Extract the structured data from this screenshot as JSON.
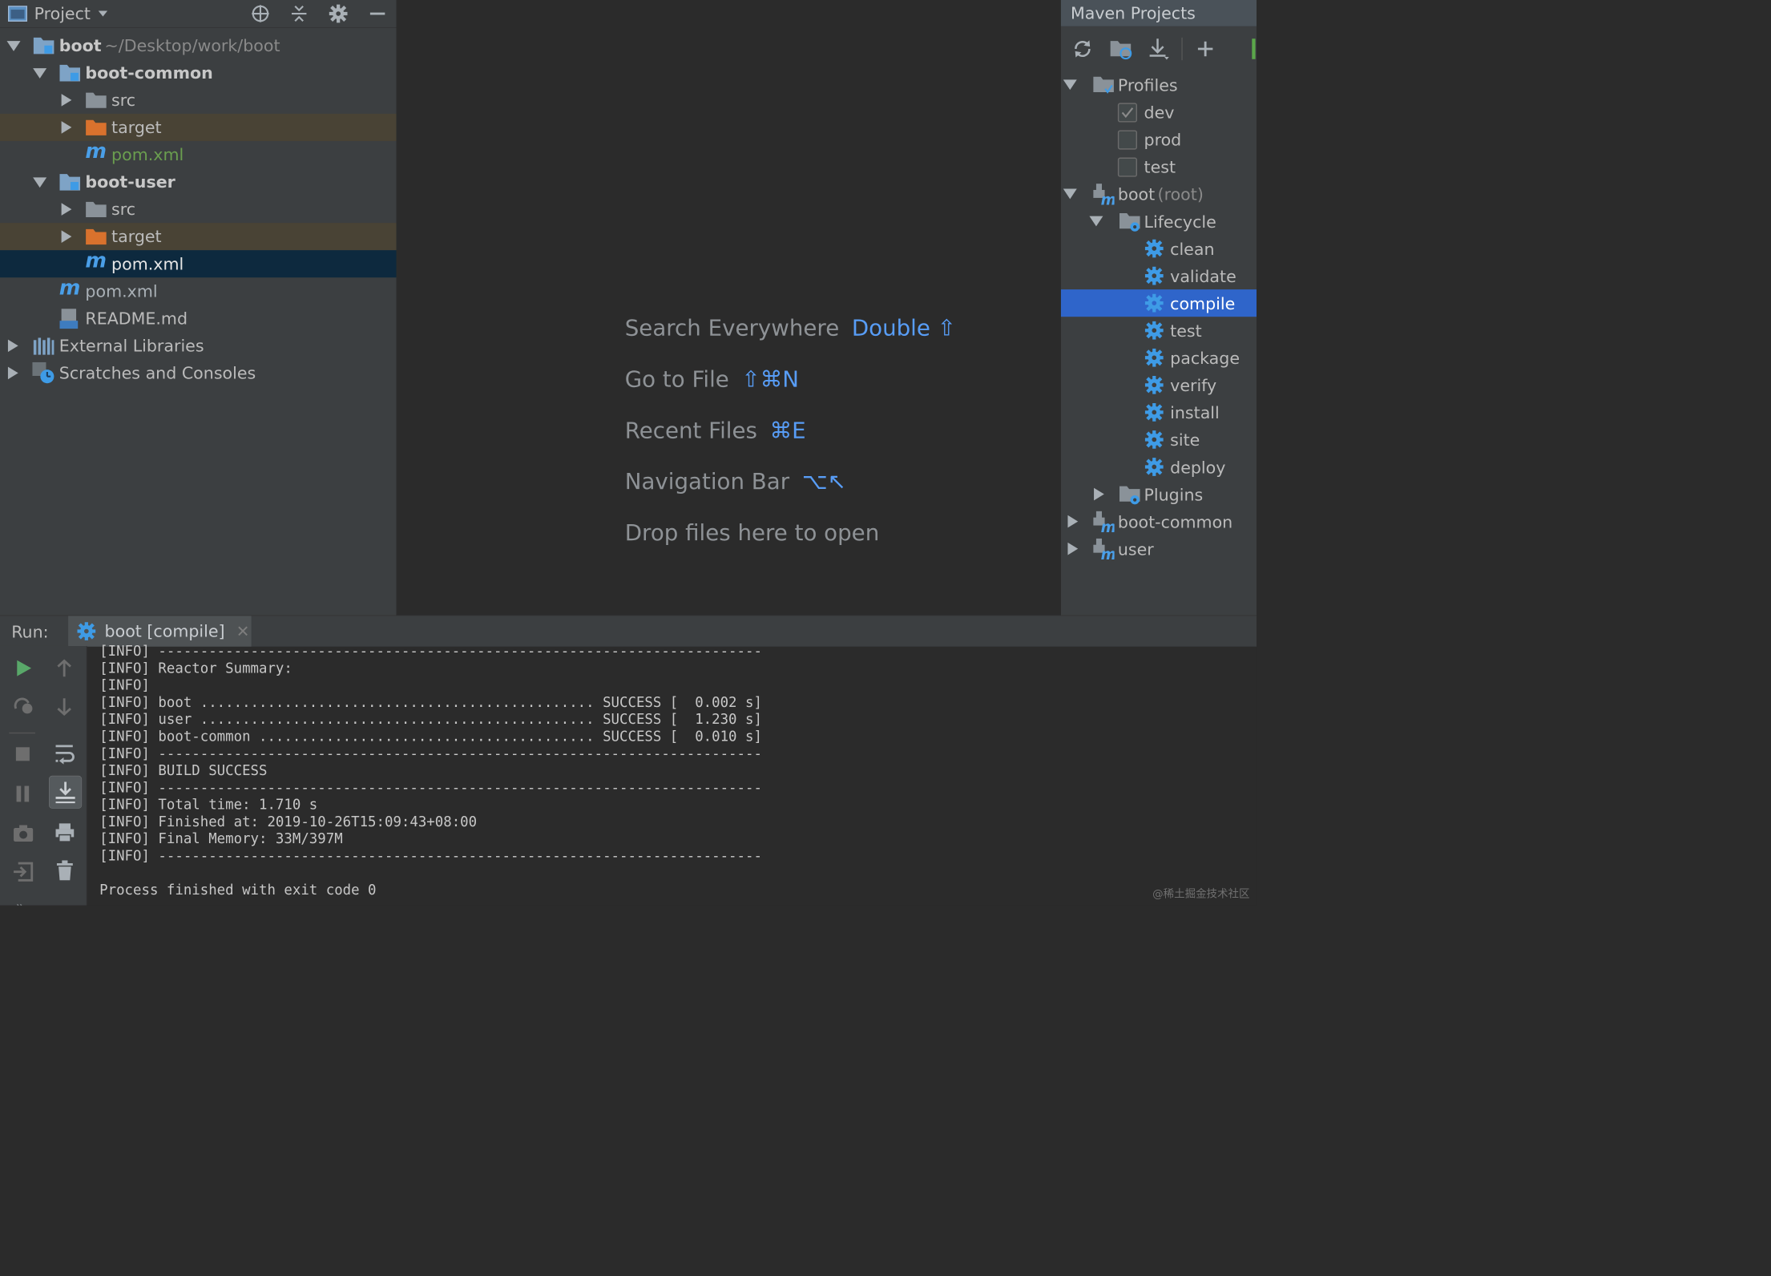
{
  "project": {
    "title": "Project",
    "tree": [
      {
        "label": "boot",
        "extra": "~/Desktop/work/boot"
      },
      {
        "label": "boot-common"
      },
      {
        "label": "src"
      },
      {
        "label": "target"
      },
      {
        "label": "pom.xml"
      },
      {
        "label": "boot-user"
      },
      {
        "label": "src"
      },
      {
        "label": "target"
      },
      {
        "label": "pom.xml"
      },
      {
        "label": "pom.xml"
      },
      {
        "label": "README.md"
      },
      {
        "label": "External Libraries"
      },
      {
        "label": "Scratches and Consoles"
      }
    ]
  },
  "editor": {
    "hints": [
      {
        "label": "Search Everywhere",
        "shortcut": "Double ⇧"
      },
      {
        "label": "Go to File",
        "shortcut": "⇧⌘N"
      },
      {
        "label": "Recent Files",
        "shortcut": "⌘E"
      },
      {
        "label": "Navigation Bar",
        "shortcut": "⌥↖"
      },
      {
        "label": "Drop files here to open",
        "shortcut": ""
      }
    ]
  },
  "maven": {
    "title": "Maven Projects",
    "profiles_label": "Profiles",
    "profiles": [
      {
        "label": "dev",
        "checked": true
      },
      {
        "label": "prod",
        "checked": false
      },
      {
        "label": "test",
        "checked": false
      }
    ],
    "root": {
      "label": "boot",
      "suffix": "(root)"
    },
    "lifecycle_label": "Lifecycle",
    "lifecycle": [
      "clean",
      "validate",
      "compile",
      "test",
      "package",
      "verify",
      "install",
      "site",
      "deploy"
    ],
    "selected_goal": "compile",
    "plugins_label": "Plugins",
    "modules": [
      "boot-common",
      "user"
    ]
  },
  "run": {
    "label": "Run:",
    "tab": "boot [compile]",
    "lines": [
      "[INFO] ------------------------------------------------------------------------",
      "[INFO] Reactor Summary:",
      "[INFO]",
      "[INFO] boot ............................................... SUCCESS [  0.002 s]",
      "[INFO] user ............................................... SUCCESS [  1.230 s]",
      "[INFO] boot-common ........................................ SUCCESS [  0.010 s]",
      "[INFO] ------------------------------------------------------------------------",
      "[INFO] BUILD SUCCESS",
      "[INFO] ------------------------------------------------------------------------",
      "[INFO] Total time: 1.710 s",
      "[INFO] Finished at: 2019-10-26T15:09:43+08:00",
      "[INFO] Final Memory: 33M/397M",
      "[INFO] ------------------------------------------------------------------------",
      "",
      "Process finished with exit code 0"
    ]
  },
  "watermark": "@稀土掘金技术社区",
  "colors": {
    "selection": "#2f65ca",
    "tree_selection": "#0d293e",
    "shortcut_blue": "#589df6",
    "folder_blue": "#7ea3c6",
    "folder_orange": "#d9722d",
    "gear_blue": "#3e9be6"
  }
}
